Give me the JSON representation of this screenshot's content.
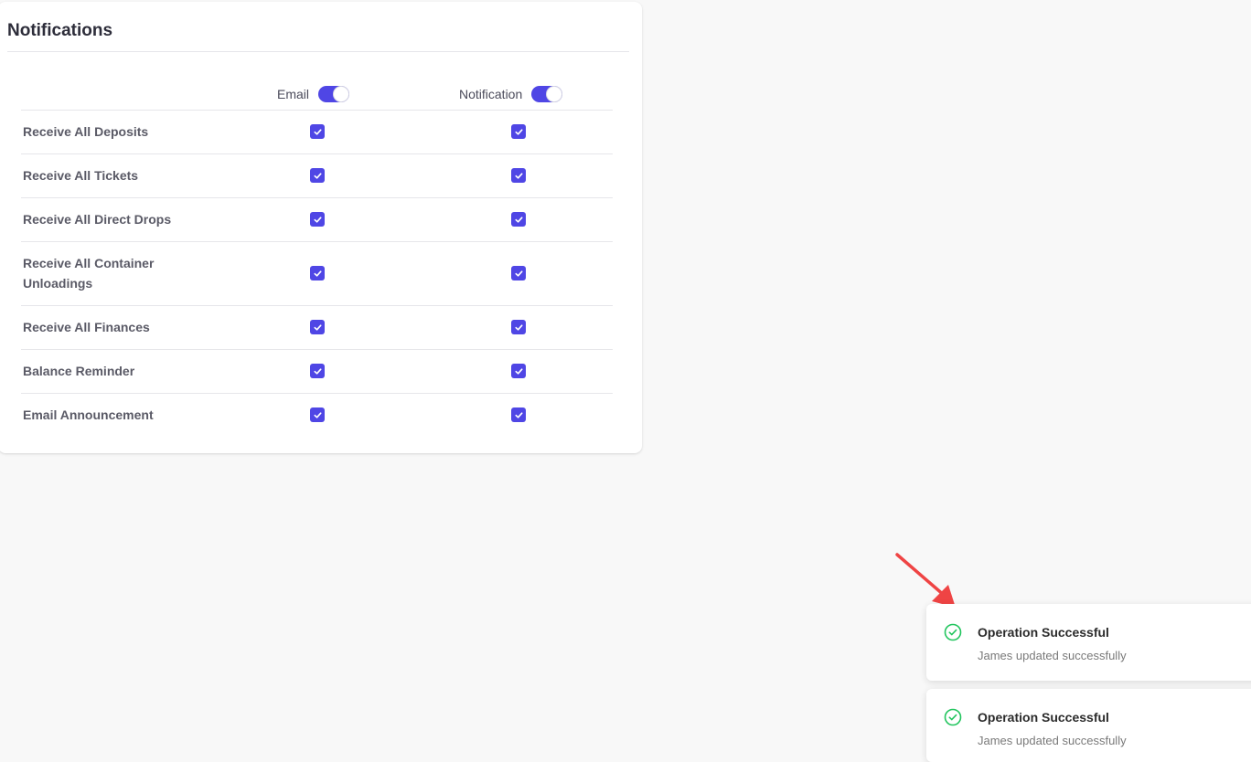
{
  "card": {
    "title": "Notifications",
    "columns": {
      "email": {
        "label": "Email",
        "toggle_on": true
      },
      "notification": {
        "label": "Notification",
        "toggle_on": true
      }
    },
    "rows": [
      {
        "label": "Receive All Deposits",
        "email": true,
        "notification": true
      },
      {
        "label": "Receive All Tickets",
        "email": true,
        "notification": true
      },
      {
        "label": "Receive All Direct Drops",
        "email": true,
        "notification": true
      },
      {
        "label": "Receive All Container Unloadings",
        "email": true,
        "notification": true
      },
      {
        "label": "Receive All Finances",
        "email": true,
        "notification": true
      },
      {
        "label": "Balance Reminder",
        "email": true,
        "notification": true
      },
      {
        "label": "Email Announcement",
        "email": true,
        "notification": true
      }
    ]
  },
  "toasts": [
    {
      "title": "Operation Successful",
      "message": "James updated successfully",
      "icon": "check-circle-icon"
    },
    {
      "title": "Operation Successful",
      "message": "James updated successfully",
      "icon": "check-circle-icon"
    }
  ],
  "colors": {
    "accent": "#4f46e5",
    "success": "#22c55e",
    "annotation_arrow": "#ef4444"
  }
}
